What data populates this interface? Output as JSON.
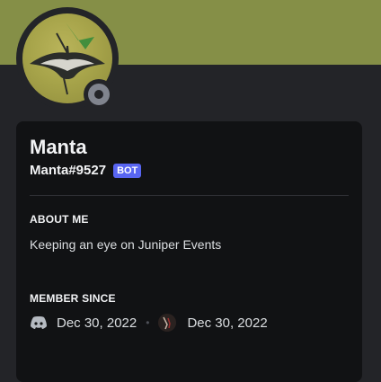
{
  "profile": {
    "display_name": "Manta",
    "username": "Manta#9527",
    "badge": "BOT",
    "status": "offline",
    "banner_color": "#858f47"
  },
  "about": {
    "heading": "ABOUT ME",
    "text": "Keeping an eye on Juniper Events"
  },
  "member_since": {
    "heading": "MEMBER SINCE",
    "discord_date": "Dec 30, 2022",
    "server_date": "Dec 30, 2022",
    "separator": "•"
  },
  "icons": {
    "discord": "discord-icon",
    "server": "server-icon",
    "status": "offline-status-icon"
  }
}
